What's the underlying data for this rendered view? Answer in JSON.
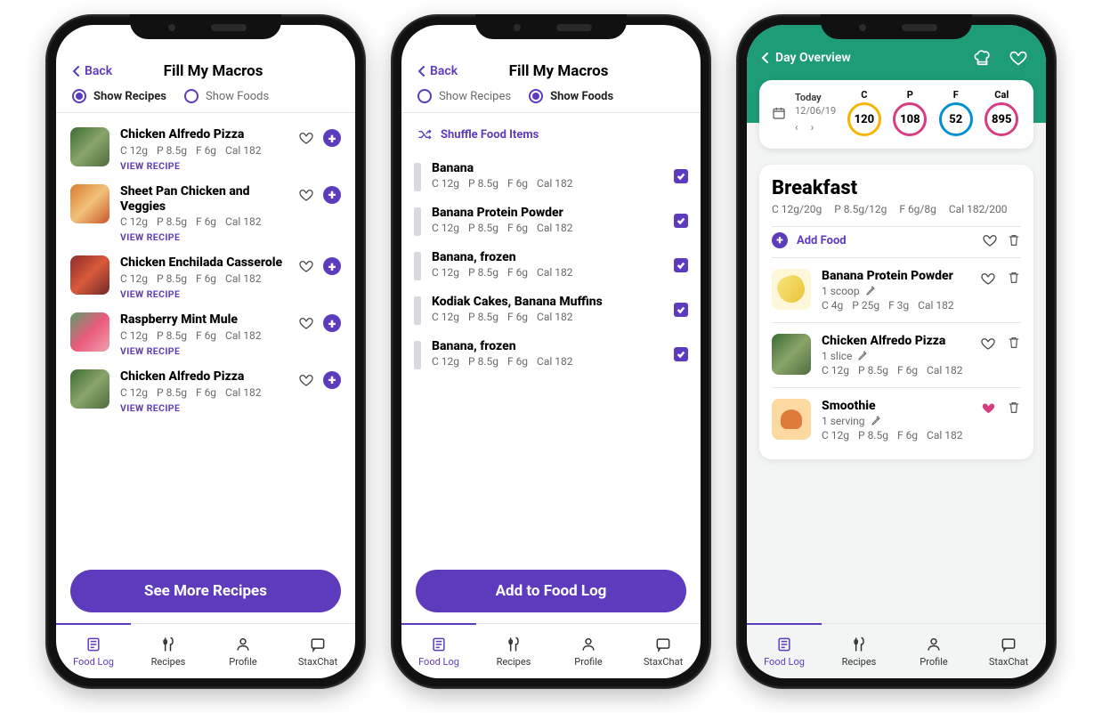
{
  "common": {
    "back": "Back",
    "tabs": {
      "foodlog": "Food Log",
      "recipes": "Recipes",
      "profile": "Profile",
      "staxchat": "StaxChat"
    },
    "macros_template": {
      "c": "C 12g",
      "p": "P 8.5g",
      "f": "F 6g",
      "cal": "Cal 182"
    }
  },
  "screen1": {
    "title": "Fill My Macros",
    "radios": {
      "recipes": "Show Recipes",
      "foods": "Show Foods",
      "selected": "recipes"
    },
    "recipes": [
      {
        "name": "Chicken Alfredo Pizza",
        "thumb": "t-green",
        "macros": {
          "c": "C 12g",
          "p": "P 8.5g",
          "f": "F 6g",
          "cal": "Cal 182"
        },
        "link": "VIEW RECIPE"
      },
      {
        "name": "Sheet Pan Chicken and Veggies",
        "thumb": "t-orange",
        "macros": {
          "c": "C 12g",
          "p": "P 8.5g",
          "f": "F 6g",
          "cal": "Cal 182"
        },
        "link": "VIEW RECIPE"
      },
      {
        "name": "Chicken Enchilada Casserole",
        "thumb": "t-red",
        "macros": {
          "c": "C 12g",
          "p": "P 8.5g",
          "f": "F 6g",
          "cal": "Cal 182"
        },
        "link": "VIEW RECIPE"
      },
      {
        "name": "Raspberry Mint Mule",
        "thumb": "t-pink",
        "macros": {
          "c": "C 12g",
          "p": "P 8.5g",
          "f": "F 6g",
          "cal": "Cal 182"
        },
        "link": "VIEW RECIPE"
      },
      {
        "name": "Chicken Alfredo Pizza",
        "thumb": "t-green",
        "macros": {
          "c": "C 12g",
          "p": "P 8.5g",
          "f": "F 6g",
          "cal": "Cal 182"
        },
        "link": "VIEW RECIPE"
      }
    ],
    "cta": "See More Recipes"
  },
  "screen2": {
    "title": "Fill My Macros",
    "radios": {
      "recipes": "Show Recipes",
      "foods": "Show Foods",
      "selected": "foods"
    },
    "shuffle": "Shuffle Food Items",
    "foods": [
      {
        "name": "Banana",
        "macros": {
          "c": "C 12g",
          "p": "P 8.5g",
          "f": "F 6g",
          "cal": "Cal 182"
        },
        "checked": true
      },
      {
        "name": "Banana Protein Powder",
        "macros": {
          "c": "C 12g",
          "p": "P 8.5g",
          "f": "F 6g",
          "cal": "Cal 182"
        },
        "checked": true
      },
      {
        "name": "Banana, frozen",
        "macros": {
          "c": "C 12g",
          "p": "P 8.5g",
          "f": "F 6g",
          "cal": "Cal 182"
        },
        "checked": true
      },
      {
        "name": "Kodiak Cakes, Banana Muffins",
        "macros": {
          "c": "C 12g",
          "p": "P 8.5g",
          "f": "F 6g",
          "cal": "Cal 182"
        },
        "checked": true
      },
      {
        "name": "Banana, frozen",
        "macros": {
          "c": "C 12g",
          "p": "P 8.5g",
          "f": "F 6g",
          "cal": "Cal 182"
        },
        "checked": true
      }
    ],
    "cta": "Add to Food Log"
  },
  "screen3": {
    "header_back": "Day Overview",
    "today": "Today",
    "date": "12/06/19",
    "rings": [
      {
        "label": "C",
        "value": "120",
        "color": "#f5b400"
      },
      {
        "label": "P",
        "value": "108",
        "color": "#d83d80"
      },
      {
        "label": "F",
        "value": "52",
        "color": "#0091d0"
      },
      {
        "label": "Cal",
        "value": "895",
        "color": "#d83d80"
      }
    ],
    "meal": {
      "title": "Breakfast",
      "totals": {
        "c": "C 12g/20g",
        "p": "P 8.5g/12g",
        "f": "F 6g/8g",
        "cal": "Cal 182/200"
      },
      "add": "Add Food",
      "items": [
        {
          "name": "Banana Protein Powder",
          "serving": "1 scoop",
          "thumb": "t-banana",
          "macros": {
            "c": "C 4g",
            "p": "P 25g",
            "f": "F 3g",
            "cal": "Cal 182"
          },
          "fav": false
        },
        {
          "name": "Chicken Alfredo Pizza",
          "serving": "1 slice",
          "thumb": "t-green",
          "macros": {
            "c": "C 12g",
            "p": "P 8.5g",
            "f": "F 6g",
            "cal": "Cal 182"
          },
          "fav": false
        },
        {
          "name": "Smoothie",
          "serving": "1 serving",
          "thumb": "t-smoothie",
          "macros": {
            "c": "C 12g",
            "p": "P 8.5g",
            "f": "F 6g",
            "cal": "Cal 182"
          },
          "fav": true
        }
      ]
    }
  }
}
